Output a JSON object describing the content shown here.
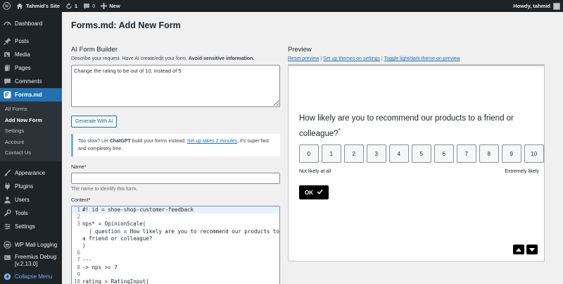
{
  "adminbar": {
    "site_name": "Tahmid's Site",
    "updates_count": "1",
    "comments_count": "0",
    "new_label": "New",
    "howdy": "Howdy, tahmid"
  },
  "sidebar": {
    "dashboard": "Dashboard",
    "posts": "Posts",
    "media": "Media",
    "pages": "Pages",
    "comments": "Comments",
    "formsmd": "Forms.md",
    "submenu": [
      "All Forms",
      "Add New Form",
      "Settings",
      "Account",
      "Contact Us"
    ],
    "appearance": "Appearance",
    "plugins": "Plugins",
    "users": "Users",
    "tools": "Tools",
    "settings": "Settings",
    "wp_mail_logging": "WP Mail Logging",
    "freemius_debug": "Freemius Debug",
    "freemius_version": "[v.2.13.0]",
    "collapse": "Collapse Menu"
  },
  "page_title": "Forms.md: Add New Form",
  "builder": {
    "title": "AI Form Builder",
    "desc_prefix": "Describe your request. Have AI create/edit your form. ",
    "desc_bold": "Avoid sensitive information.",
    "prompt_value": "Change the rating to be out of 10, instead of 5",
    "generate_label": "Generate With AI",
    "notice_prefix": "Too slow? Let ",
    "notice_bold": "ChatGPT",
    "notice_mid": " build your forms instead. ",
    "notice_link": "Set up takes 2 minutes",
    "notice_suffix": ", it's super fast and completely free."
  },
  "name_field": {
    "label": "Name",
    "required": "*",
    "value": "",
    "hint": "The name to identify this form."
  },
  "content_field": {
    "label": "Content",
    "required": "*"
  },
  "code_lines": [
    {
      "n": "1",
      "t": "#! id = shoe-shop-customer-feedback"
    },
    {
      "n": "2",
      "t": ""
    },
    {
      "n": "3",
      "t": "nps* = OpinionScale("
    },
    {
      "n": "",
      "t": "  | question = How likely are you to recommend our products to"
    },
    {
      "n": "",
      "t": "a friend or colleague?"
    },
    {
      "n": "",
      "t": ")"
    },
    {
      "n": "6",
      "t": ""
    },
    {
      "n": "7",
      "t": "---"
    },
    {
      "n": "8",
      "t": "-> nps >= 7"
    },
    {
      "n": "9",
      "t": ""
    },
    {
      "n": "10",
      "t": "rating = RatingInput("
    }
  ],
  "preview": {
    "title": "Preview",
    "link_reset": "Reset preview",
    "link_themes": "Set up themes on settings",
    "link_toggle": "Toggle light/dark theme on preview",
    "sep": " | ",
    "question": "How likely are you to recommend our products to a friend or colleague?",
    "required_mark": "*",
    "scale": [
      "0",
      "1",
      "2",
      "3",
      "4",
      "5",
      "6",
      "7",
      "8",
      "9",
      "10"
    ],
    "low_label": "Not likely at all",
    "high_label": "Extremely likely",
    "ok_label": "OK"
  },
  "colors": {
    "accent": "#2271b1",
    "sidebar_bg": "#1d2327",
    "notice_border": "#72aee6"
  }
}
